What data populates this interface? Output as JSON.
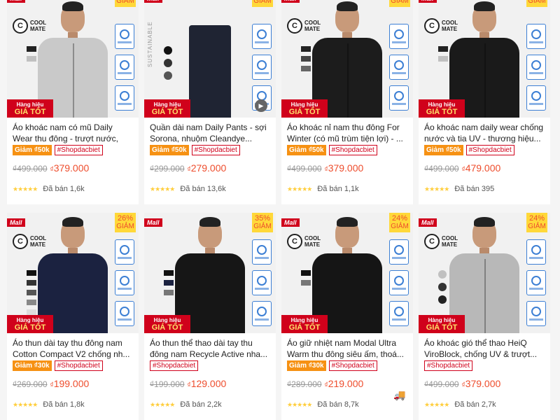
{
  "products": [
    {
      "title": "Áo khoác nam có mũ Daily Wear thu đông - trượt nước, chống ...",
      "discount": "",
      "discount_label": "GIẢM",
      "tag_discount": "Giảm ₫50k",
      "tag_hashtag": "#Shopdacbiet",
      "old_price": "₫499.000",
      "new_price": "379.000",
      "currency": "₫",
      "sold": "Đã bán 1,6k",
      "cloth_color": "#c9c9c9",
      "swatches": [
        "#222222",
        "#c0c0c0"
      ]
    },
    {
      "title": "Quần dài nam Daily Pants - sợi Sorona, nhuộm Cleandye...",
      "discount": "",
      "discount_label": "GIẢM",
      "tag_discount": "Giảm ₫50k",
      "tag_hashtag": "#Shopdacbiet",
      "old_price": "₫299.000",
      "new_price": "279.000",
      "currency": "₫",
      "sold": "Đã bán 13,6k",
      "cloth_color": "#1f2433",
      "swatches": [
        "#111111",
        "#333333",
        "#555555"
      ]
    },
    {
      "title": "Áo khoác nỉ nam thu đông For Winter (có mũ trùm tiện lợi) - ...",
      "discount": "",
      "discount_label": "GIẢM",
      "tag_discount": "Giảm ₫50k",
      "tag_hashtag": "#Shopdacbiet",
      "old_price": "₫499.000",
      "new_price": "379.000",
      "currency": "₫",
      "sold": "Đã bán 1,1k",
      "cloth_color": "#1c1c1c",
      "swatches": [
        "#222222",
        "#444444",
        "#666666"
      ]
    },
    {
      "title": "Áo khoác nam daily wear chống nước và tia UV - thương hiệu...",
      "discount": "",
      "discount_label": "GIẢM",
      "tag_discount": "Giảm ₫50k",
      "tag_hashtag": "#Shopdacbiet",
      "old_price": "₫499.000",
      "new_price": "479.000",
      "currency": "₫",
      "sold": "Đã bán 395",
      "cloth_color": "#1a1a1a",
      "swatches": [
        "#222222",
        "#c0c0c0"
      ]
    },
    {
      "title": "Áo thun dài tay thu đông nam Cotton Compact V2 chống nh...",
      "discount": "26%",
      "discount_label": "GIẢM",
      "tag_discount": "Giảm ₫30k",
      "tag_hashtag": "#Shopdacbiet",
      "old_price": "₫269.000",
      "new_price": "199.000",
      "currency": "₫",
      "sold": "Đã bán 1,8k",
      "cloth_color": "#1b2240",
      "swatches": [
        "#111111",
        "#333333",
        "#555555",
        "#888888",
        "#dddddd"
      ]
    },
    {
      "title": "Áo thun thể thao dài tay thu đông nam Recycle Active nha...",
      "discount": "35%",
      "discount_label": "GIẢM",
      "tag_discount": "",
      "tag_hashtag": "#Shopdacbiet",
      "old_price": "₫199.000",
      "new_price": "129.000",
      "currency": "₫",
      "sold": "Đã bán 2,2k",
      "cloth_color": "#161616",
      "swatches": [
        "#111111",
        "#1b2240",
        "#777777"
      ]
    },
    {
      "title": "Áo giữ nhiệt nam Modal Ultra Warm thu đông siêu ấm, thoá...",
      "discount": "24%",
      "discount_label": "GIẢM",
      "tag_discount": "Giảm ₫30k",
      "tag_hashtag": "#Shopdacbiet",
      "old_price": "₫289.000",
      "new_price": "219.000",
      "currency": "₫",
      "sold": "Đã bán 8,7k",
      "cloth_color": "#151515",
      "swatches": [
        "#111111",
        "#777777"
      ]
    },
    {
      "title": "Áo khoác gió thể thao HeiQ ViroBlock, chống UV & trượt...",
      "discount": "24%",
      "discount_label": "GIẢM",
      "tag_discount": "",
      "tag_hashtag": "#Shopdacbiet",
      "old_price": "₫499.000",
      "new_price": "379.000",
      "currency": "₫",
      "sold": "Đã bán 2,7k",
      "cloth_color": "#b8b8b8",
      "swatches": [
        "#c0c0c0",
        "#333333",
        "#222222"
      ]
    }
  ],
  "common": {
    "mall_label": "Mall",
    "logo_letter": "C",
    "logo_line1": "COOL",
    "logo_line2": "MATE",
    "banner_line1": "Hàng hiệu",
    "banner_line2": "GIÁ TỐT",
    "sustainable": "SUSTAINABLE",
    "play_icon": "▶",
    "truck_icon": "🚚",
    "stars": "★★★★★",
    "accent_color": "#ee4d2d",
    "mall_color": "#d0011b"
  }
}
